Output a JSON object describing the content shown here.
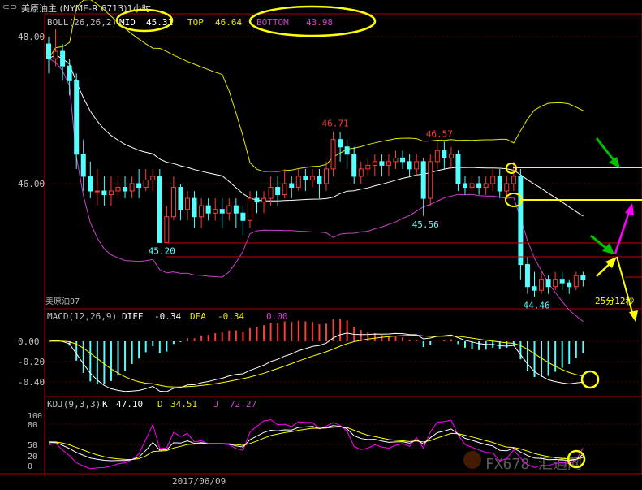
{
  "window": {
    "title": "美原油主 (NYME-R 6713)1小时",
    "icon_name": "link-icon"
  },
  "colors": {
    "up": "#ff3b3b",
    "down": "#54ffff",
    "mid": "#ffffff",
    "top": "#e6e600",
    "bottom": "#d040d0",
    "axis": "#aa0000",
    "grid": "#5a0000",
    "highlight_yellow": "#ffff00",
    "green_arrow": "#00c000",
    "magenta_arrow": "#ff00ff",
    "k_line": "#ffffff",
    "d_line": "#ffff00",
    "j_line": "#ff00ff"
  },
  "main_panel": {
    "indicator": "BOLL(26,26,2)",
    "mid_label": "MID",
    "mid_value": "45.31",
    "top_label": "TOP",
    "top_value": "46.64",
    "bottom_label": "BOTTOM",
    "bottom_value": "43.98",
    "sub_label": "美原油07",
    "time_note": "25分12秒"
  },
  "macd_panel": {
    "indicator": "MACD(12,26,9)",
    "diff_label": "DIFF",
    "diff_value": "-0.34",
    "dea_label": "DEA",
    "dea_value": "-0.34",
    "macd_value": "0.00"
  },
  "kdj_panel": {
    "indicator": "KDJ(9,3,3)",
    "k_label": "K",
    "k_value": "47.10",
    "d_label": "D",
    "d_value": "34.51",
    "j_label": "J",
    "j_value": "72.27"
  },
  "x_axis": {
    "date_label": "2017/06/09"
  },
  "watermark": {
    "text": "FX678 汇通网"
  },
  "chart_data": {
    "type": "candlestick",
    "price_axis": {
      "ticks": [
        "48.00",
        "46.00"
      ],
      "ylim": [
        43.7,
        48.2
      ]
    },
    "annotations": [
      {
        "label": "45.20",
        "kind": "low"
      },
      {
        "label": "46.71",
        "kind": "high"
      },
      {
        "label": "45.56",
        "kind": "low"
      },
      {
        "label": "46.57",
        "kind": "high"
      },
      {
        "label": "44.46",
        "kind": "low"
      }
    ],
    "candles": [
      [
        47.9,
        47.7,
        48.0,
        47.5
      ],
      [
        47.7,
        47.8,
        48.1,
        47.6
      ],
      [
        47.8,
        47.6,
        47.9,
        47.4
      ],
      [
        47.6,
        47.4,
        47.7,
        47.2
      ],
      [
        47.4,
        46.4,
        47.5,
        46.2
      ],
      [
        46.4,
        46.1,
        46.6,
        45.9
      ],
      [
        46.1,
        45.9,
        46.3,
        45.8
      ],
      [
        45.9,
        45.9,
        46.2,
        45.7
      ],
      [
        45.9,
        45.85,
        46.1,
        45.7
      ],
      [
        45.85,
        45.9,
        46.1,
        45.7
      ],
      [
        45.9,
        45.95,
        46.1,
        45.8
      ],
      [
        45.95,
        45.9,
        46.1,
        45.8
      ],
      [
        45.9,
        46.0,
        46.1,
        45.8
      ],
      [
        46.0,
        45.95,
        46.2,
        45.8
      ],
      [
        45.95,
        46.05,
        46.2,
        45.9
      ],
      [
        46.05,
        46.1,
        46.2,
        45.9
      ],
      [
        46.1,
        45.2,
        46.2,
        45.2
      ],
      [
        45.2,
        45.55,
        45.7,
        45.2
      ],
      [
        45.55,
        45.95,
        46.1,
        45.5
      ],
      [
        45.95,
        45.65,
        46.0,
        45.5
      ],
      [
        45.65,
        45.8,
        45.9,
        45.5
      ],
      [
        45.8,
        45.55,
        45.9,
        45.4
      ],
      [
        45.55,
        45.7,
        45.8,
        45.4
      ],
      [
        45.7,
        45.6,
        45.8,
        45.5
      ],
      [
        45.6,
        45.65,
        45.8,
        45.5
      ],
      [
        45.65,
        45.6,
        45.8,
        45.4
      ],
      [
        45.6,
        45.7,
        45.8,
        45.5
      ],
      [
        45.7,
        45.6,
        45.8,
        45.4
      ],
      [
        45.6,
        45.5,
        45.7,
        45.3
      ],
      [
        45.5,
        45.8,
        45.9,
        45.4
      ],
      [
        45.8,
        45.75,
        45.9,
        45.6
      ],
      [
        45.75,
        45.8,
        45.9,
        45.6
      ],
      [
        45.8,
        45.95,
        46.1,
        45.7
      ],
      [
        45.95,
        45.85,
        46.1,
        45.7
      ],
      [
        45.85,
        46.0,
        46.2,
        45.8
      ],
      [
        46.0,
        45.95,
        46.1,
        45.8
      ],
      [
        45.95,
        46.1,
        46.2,
        45.9
      ],
      [
        46.1,
        46.05,
        46.2,
        45.9
      ],
      [
        46.05,
        46.1,
        46.2,
        45.95
      ],
      [
        46.1,
        46.0,
        46.2,
        45.8
      ],
      [
        46.0,
        46.2,
        46.3,
        45.9
      ],
      [
        46.2,
        46.6,
        46.71,
        46.1
      ],
      [
        46.6,
        46.5,
        46.7,
        46.3
      ],
      [
        46.5,
        46.4,
        46.6,
        46.2
      ],
      [
        46.4,
        46.1,
        46.5,
        46.0
      ],
      [
        46.1,
        46.2,
        46.3,
        46.0
      ],
      [
        46.2,
        46.25,
        46.35,
        46.1
      ],
      [
        46.25,
        46.3,
        46.4,
        46.1
      ],
      [
        46.3,
        46.25,
        46.4,
        46.1
      ],
      [
        46.25,
        46.3,
        46.4,
        46.1
      ],
      [
        46.3,
        46.35,
        46.45,
        46.2
      ],
      [
        46.35,
        46.3,
        46.45,
        46.2
      ],
      [
        46.3,
        46.2,
        46.4,
        46.1
      ],
      [
        46.2,
        46.3,
        46.4,
        46.1
      ],
      [
        46.3,
        45.8,
        46.35,
        45.56
      ],
      [
        45.8,
        46.3,
        46.4,
        45.7
      ],
      [
        46.3,
        46.45,
        46.57,
        46.2
      ],
      [
        46.45,
        46.35,
        46.57,
        46.2
      ],
      [
        46.35,
        46.4,
        46.5,
        46.2
      ],
      [
        46.4,
        46.0,
        46.45,
        45.9
      ],
      [
        46.0,
        45.95,
        46.1,
        45.85
      ],
      [
        45.95,
        46.0,
        46.1,
        45.9
      ],
      [
        46.0,
        45.95,
        46.1,
        45.85
      ],
      [
        45.95,
        46.0,
        46.1,
        45.85
      ],
      [
        46.0,
        46.1,
        46.2,
        45.9
      ],
      [
        46.1,
        45.9,
        46.2,
        45.8
      ],
      [
        45.9,
        46.0,
        46.1,
        45.8
      ],
      [
        46.0,
        46.1,
        46.3,
        45.9
      ],
      [
        46.1,
        44.9,
        46.2,
        44.7
      ],
      [
        44.9,
        44.6,
        45.0,
        44.5
      ],
      [
        44.6,
        44.55,
        44.8,
        44.46
      ],
      [
        44.55,
        44.7,
        44.8,
        44.5
      ],
      [
        44.7,
        44.6,
        44.75,
        44.5
      ],
      [
        44.6,
        44.7,
        44.8,
        44.55
      ],
      [
        44.7,
        44.65,
        44.8,
        44.55
      ],
      [
        44.65,
        44.6,
        44.7,
        44.5
      ],
      [
        44.6,
        44.75,
        44.8,
        44.55
      ],
      [
        44.75,
        44.7,
        44.8,
        44.6
      ]
    ]
  }
}
